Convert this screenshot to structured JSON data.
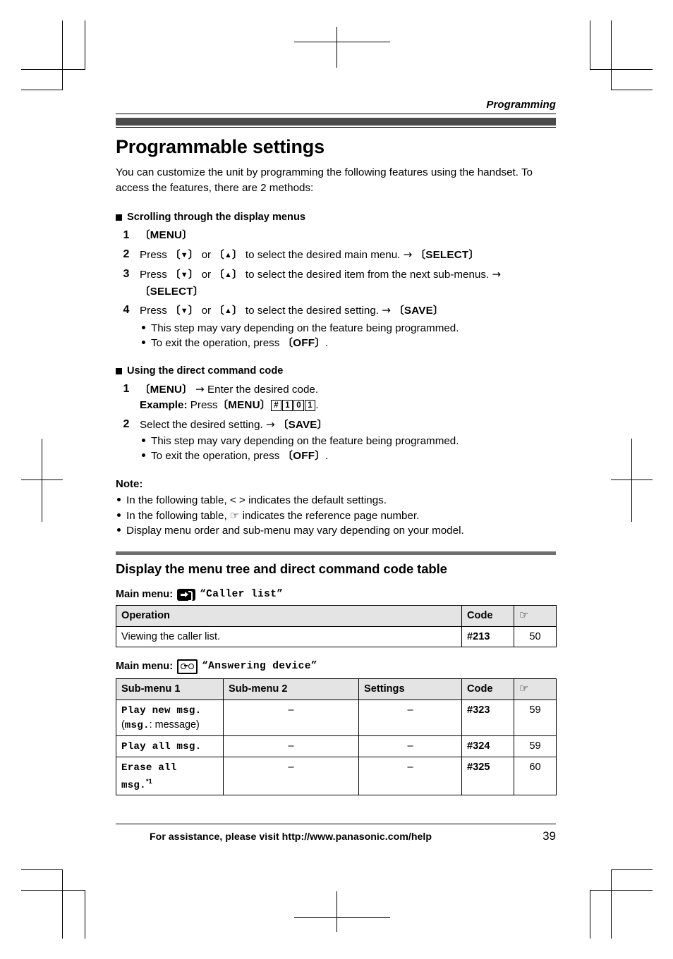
{
  "page": {
    "running_head": "Programming",
    "title": "Programmable settings",
    "intro": "You can customize the unit by programming the following features using the handset. To access the features, there are 2 methods:"
  },
  "section_scrolling": {
    "heading": "Scrolling through the display menus",
    "steps": [
      {
        "num": "1",
        "text_before": "",
        "keys": [
          "MENU"
        ],
        "plain": "[MENU]"
      },
      {
        "num": "2",
        "plain": "Press [v] or [^] to select the desired main menu. → [SELECT]",
        "press_label": "Press",
        "or_label": "or",
        "tail": "to select the desired main menu.",
        "result_key": "SELECT"
      },
      {
        "num": "3",
        "plain": "Press [v] or [^] to select the desired item from the next sub-menus. → [SELECT]",
        "press_label": "Press",
        "or_label": "or",
        "tail": "to select the desired item from the next sub-menus.",
        "result_key": "SELECT"
      },
      {
        "num": "4",
        "plain": "Press [v] or [^] to select the desired setting. → [SAVE]",
        "press_label": "Press",
        "or_label": "or",
        "tail": "to select the desired setting.",
        "result_key": "SAVE",
        "bullets": [
          "This step may vary depending on the feature being programmed.",
          "To exit the operation, press [OFF]."
        ],
        "bullet1": "This step may vary depending on the feature being programmed.",
        "bullet2_before": "To exit the operation, press",
        "bullet2_key": "OFF"
      }
    ]
  },
  "section_directcode": {
    "heading": "Using the direct command code",
    "step1": {
      "num": "1",
      "key": "MENU",
      "after_arrow": "Enter the desired code.",
      "example_label": "Example:",
      "example_press": "Press",
      "example_key": "MENU",
      "example_boxes": [
        "#",
        "1",
        "0",
        "1"
      ],
      "example_period": "."
    },
    "step2": {
      "num": "2",
      "text": "Select the desired setting.",
      "result_key": "SAVE",
      "bullet1": "This step may vary depending on the feature being programmed.",
      "bullet2_before": "To exit the operation, press",
      "bullet2_key": "OFF"
    }
  },
  "note": {
    "label": "Note:",
    "items": [
      "In the following table, < > indicates the default settings.",
      "In the following table, ☞ indicates the reference page number.",
      "Display menu order and sub-menu may vary depending on your model."
    ],
    "item1": "In the following table, < > indicates the default settings.",
    "item2_before": "In the following table,",
    "item2_after": "indicates the reference page number.",
    "item3": "Display menu order and sub-menu may vary depending on your model."
  },
  "section_table": {
    "title": "Display the menu tree and direct command code table",
    "main_menu_label": "Main menu:",
    "tables": [
      {
        "icon": "caller-list-icon",
        "menu_name": "“Caller list”",
        "headers": [
          "Operation",
          "Code",
          "hand-icon"
        ],
        "header_operation": "Operation",
        "header_code": "Code",
        "rows": [
          {
            "operation": "Viewing the caller list.",
            "code": "#213",
            "ref": "50"
          }
        ]
      },
      {
        "icon": "answering-device-icon",
        "menu_name": "“Answering device”",
        "header_sub1": "Sub-menu 1",
        "header_sub2": "Sub-menu 2",
        "header_settings": "Settings",
        "header_code": "Code",
        "rows": [
          {
            "sub1": "Play new msg.",
            "sub1_note_mono": "msg.",
            "sub1_note_rest": ": message",
            "sub2": "–",
            "settings": "–",
            "code": "#323",
            "ref": "59"
          },
          {
            "sub1": "Play all msg.",
            "sub2": "–",
            "settings": "–",
            "code": "#324",
            "ref": "59"
          },
          {
            "sub1": "Erase all",
            "sub1_line2": "msg.",
            "sub1_footnote": "*1",
            "sub2": "–",
            "settings": "–",
            "code": "#325",
            "ref": "60"
          }
        ]
      }
    ]
  },
  "footer": {
    "assistance": "For assistance, please visit http://www.panasonic.com/help",
    "page_number": "39"
  },
  "colors": {
    "chapter_bar": "#4a4a4a",
    "section_rule": "#6e6e6e",
    "table_header_bg": "#e4e4e4"
  }
}
